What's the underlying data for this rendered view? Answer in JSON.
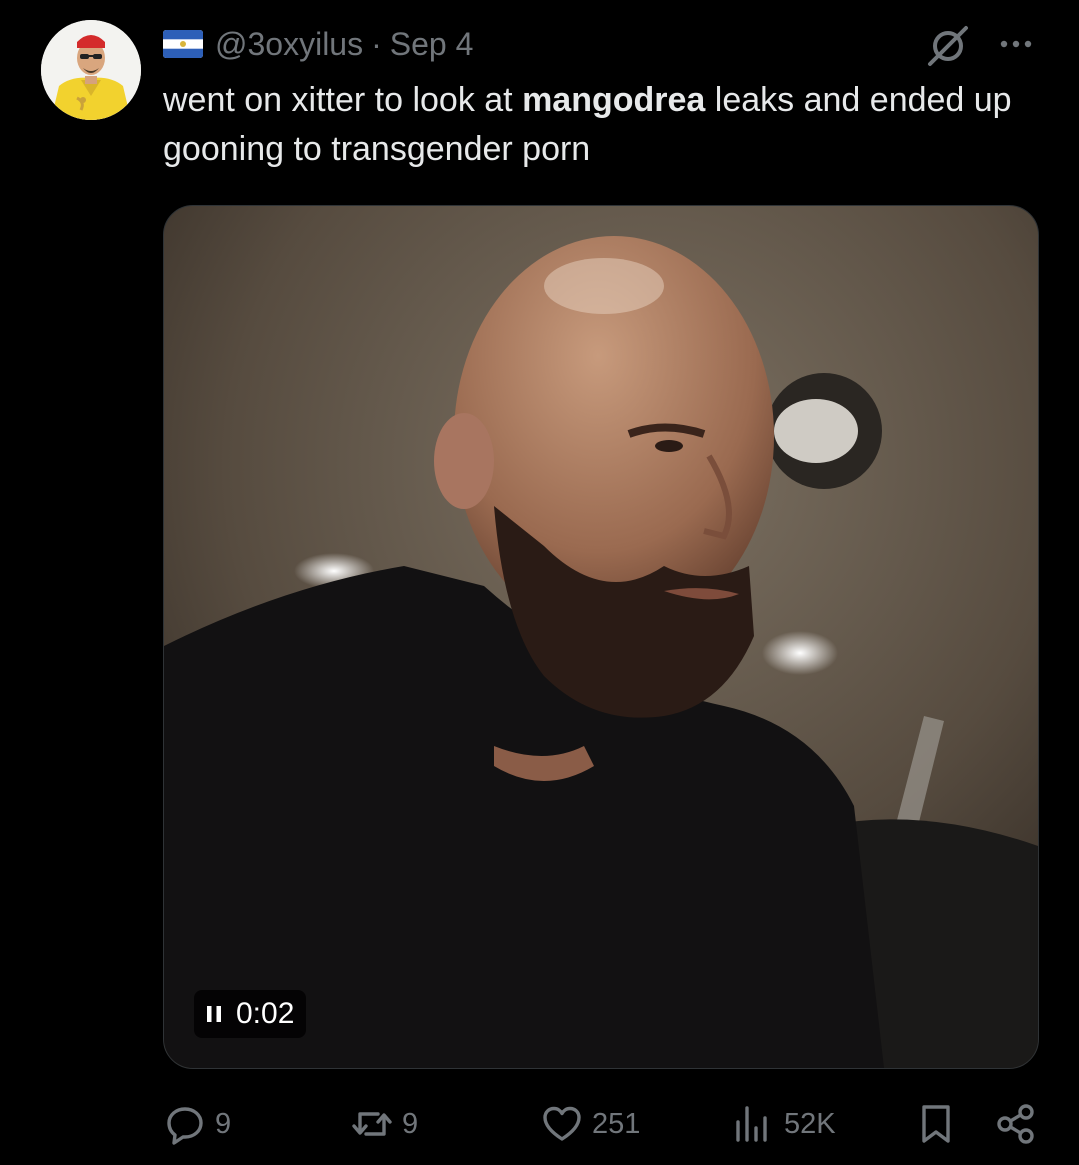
{
  "tweet": {
    "handle": "@3oxyilus",
    "date": "Sep 4",
    "separator": "·",
    "text_before": "went on xitter to look at ",
    "text_bold": "mangodrea",
    "text_after": " leaks and ended up gooning to transgender porn"
  },
  "video": {
    "time": "0:02"
  },
  "actions": {
    "replies": "9",
    "reposts": "9",
    "likes": "251",
    "views": "52K"
  },
  "icons": {
    "flag": "el-salvador-flag-icon",
    "grok": "grok-icon",
    "more": "more-icon",
    "reply": "reply-icon",
    "repost": "repost-icon",
    "like": "heart-icon",
    "views": "views-icon",
    "bookmark": "bookmark-icon",
    "share": "share-icon"
  },
  "colors": {
    "background": "#000000",
    "text": "#e7e9ea",
    "muted": "#71767b",
    "border": "#2f3336"
  }
}
